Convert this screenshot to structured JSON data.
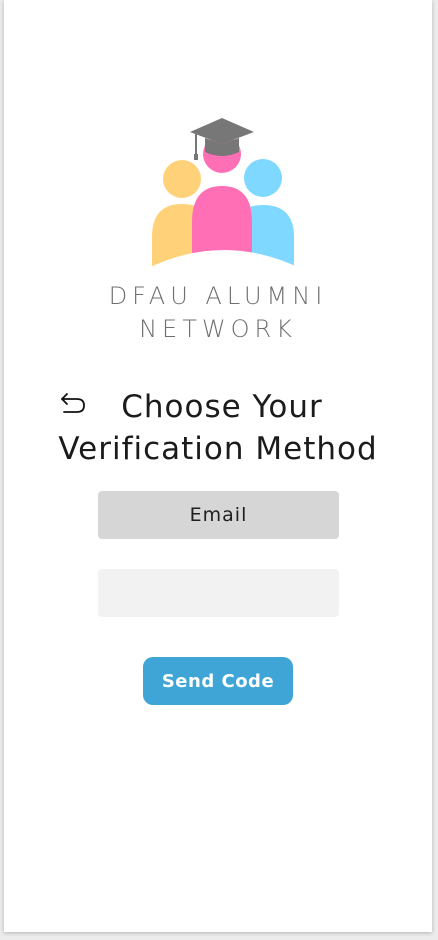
{
  "brand": {
    "line1": "DFAU ALUMNI",
    "line2": "NETWORK",
    "logo_icon": "alumni-group-graduation-cap-logo"
  },
  "header": {
    "back_icon": "back-arrow-icon",
    "title_line1": "Choose Your",
    "title_line2": "Verification Method"
  },
  "form": {
    "method_label": "Email",
    "code_value": "",
    "code_placeholder": "",
    "send_label": "Send Code"
  },
  "colors": {
    "accent": "#3ea5d6",
    "method_bg": "#d6d6d6",
    "input_bg": "#f2f2f2",
    "logo_yellow": "#ffd27a",
    "logo_pink": "#ff6fb5",
    "logo_blue": "#7fd8ff",
    "cap_gray": "#777777"
  }
}
